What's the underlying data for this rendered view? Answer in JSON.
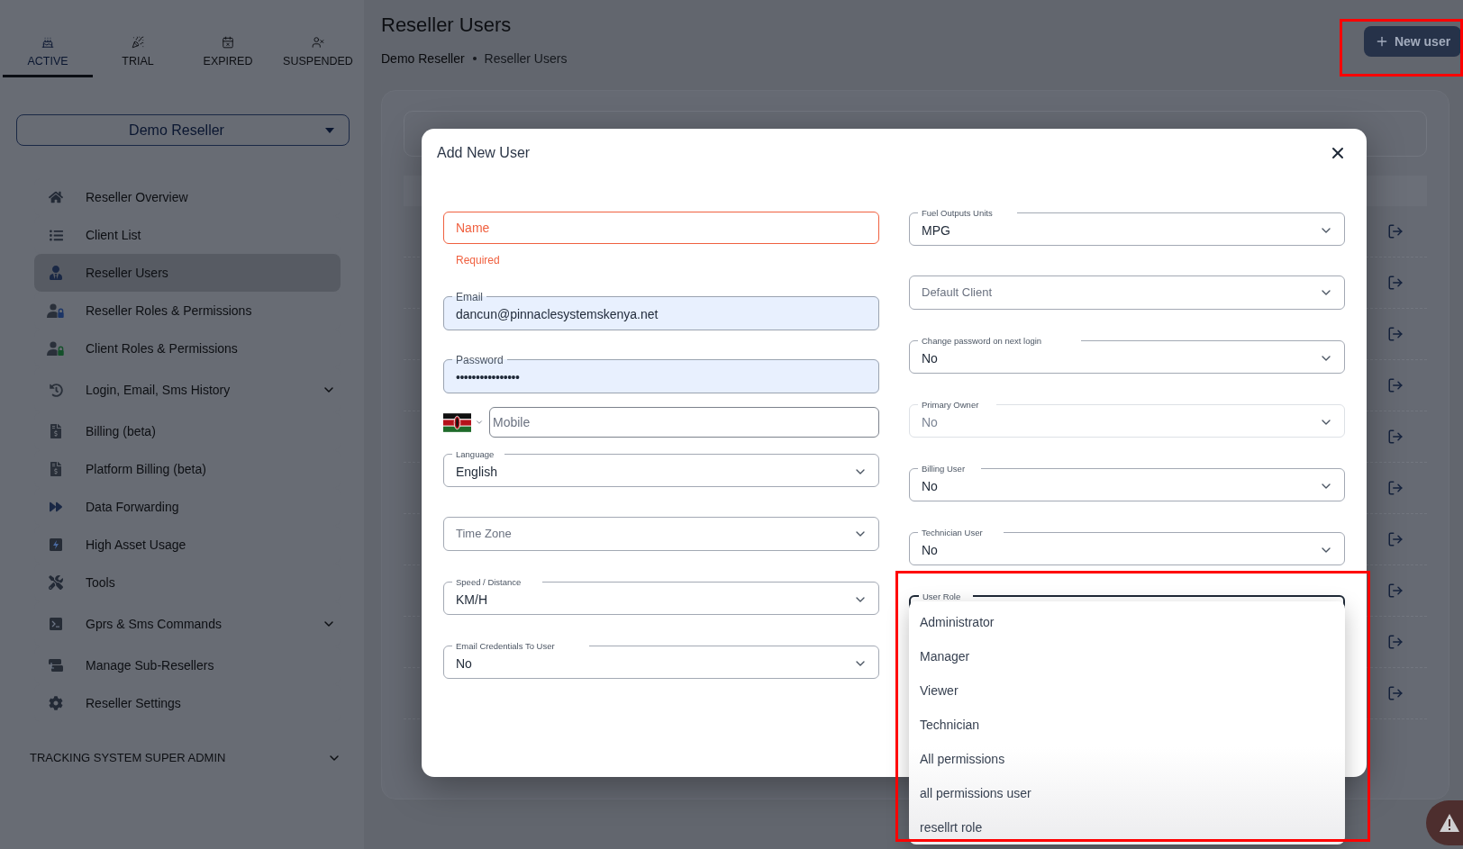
{
  "sidebar": {
    "tabs": [
      {
        "label": "ACTIVE",
        "selected": true
      },
      {
        "label": "TRIAL",
        "selected": false
      },
      {
        "label": "EXPIRED",
        "selected": false
      },
      {
        "label": "SUSPENDED",
        "selected": false
      }
    ],
    "reseller_select": {
      "value": "Demo Reseller"
    },
    "nav_items": [
      {
        "kind": "link",
        "label": "Reseller Overview",
        "selected": false
      },
      {
        "kind": "link",
        "label": "Client List",
        "selected": false
      },
      {
        "kind": "link",
        "label": "Reseller Users",
        "selected": true
      },
      {
        "kind": "link",
        "label": "Reseller Roles & Permissions",
        "selected": false
      },
      {
        "kind": "link",
        "label": "Client Roles & Permissions",
        "selected": false
      },
      {
        "kind": "group",
        "label": "Login, Email, Sms History",
        "selected": false,
        "expanded": false
      },
      {
        "kind": "link",
        "label": "Billing (beta)",
        "selected": false
      },
      {
        "kind": "link",
        "label": "Platform Billing (beta)",
        "selected": false
      },
      {
        "kind": "link",
        "label": "Data Forwarding",
        "selected": false
      },
      {
        "kind": "link",
        "label": "High Asset Usage",
        "selected": false
      },
      {
        "kind": "link",
        "label": "Tools",
        "selected": false
      },
      {
        "kind": "group",
        "label": "Gprs & Sms Commands",
        "selected": false,
        "expanded": false
      },
      {
        "kind": "link",
        "label": "Manage Sub-Resellers",
        "selected": false
      },
      {
        "kind": "link",
        "label": "Reseller Settings",
        "selected": false
      }
    ],
    "section": {
      "label": "TRACKING SYSTEM SUPER ADMIN",
      "expanded": false
    }
  },
  "header": {
    "title": "Reseller Users",
    "breadcrumb": [
      "Demo Reseller",
      "Reseller Users"
    ],
    "new_user_button": "New user"
  },
  "dialog": {
    "title": "Add New User",
    "left_fields": [
      {
        "kind": "text",
        "placeholder": "Name",
        "invalid": true,
        "error": "Required",
        "autofilled": false
      },
      {
        "kind": "text",
        "label": "Email",
        "value": "dancun@pinnaclesystemskenya.net",
        "invalid": false,
        "autofilled": true
      },
      {
        "kind": "password",
        "label": "Password",
        "value": "••••••••••••••••",
        "invalid": false,
        "autofilled": true
      },
      {
        "kind": "phone",
        "placeholder": "Mobile"
      },
      {
        "kind": "select",
        "label": "Language",
        "value": "English",
        "disabled": false,
        "expanded": false
      },
      {
        "kind": "select",
        "placeholder": "Time Zone",
        "disabled": false,
        "expanded": false
      },
      {
        "kind": "select",
        "label": "Speed / Distance",
        "value": "KM/H",
        "disabled": false,
        "expanded": false
      },
      {
        "kind": "select",
        "label": "Email Credentials To User",
        "value": "No",
        "disabled": false,
        "expanded": false
      }
    ],
    "right_fields": [
      {
        "kind": "select",
        "label": "Fuel Outputs Units",
        "value": "MPG",
        "disabled": false,
        "expanded": false
      },
      {
        "kind": "select",
        "placeholder": "Default Client",
        "disabled": false,
        "expanded": false
      },
      {
        "kind": "select",
        "label": "Change password on next login",
        "value": "No",
        "disabled": false,
        "expanded": false
      },
      {
        "kind": "select",
        "label": "Primary Owner",
        "value": "No",
        "disabled": true,
        "expanded": false
      },
      {
        "kind": "select",
        "label": "Billing User",
        "value": "No",
        "disabled": false,
        "expanded": false
      },
      {
        "kind": "select",
        "label": "Technician User",
        "value": "No",
        "disabled": false,
        "expanded": false
      },
      {
        "kind": "select",
        "label": "User Role",
        "disabled": false,
        "expanded": true,
        "options": [
          {
            "label": "Administrator",
            "selected": false
          },
          {
            "label": "Manager",
            "selected": false
          },
          {
            "label": "Viewer",
            "selected": false
          },
          {
            "label": "Technician",
            "selected": false
          },
          {
            "label": "All permissions",
            "selected": false
          },
          {
            "label": "all permissions user",
            "selected": false
          },
          {
            "label": "resellrt role",
            "selected": false
          }
        ]
      }
    ]
  }
}
